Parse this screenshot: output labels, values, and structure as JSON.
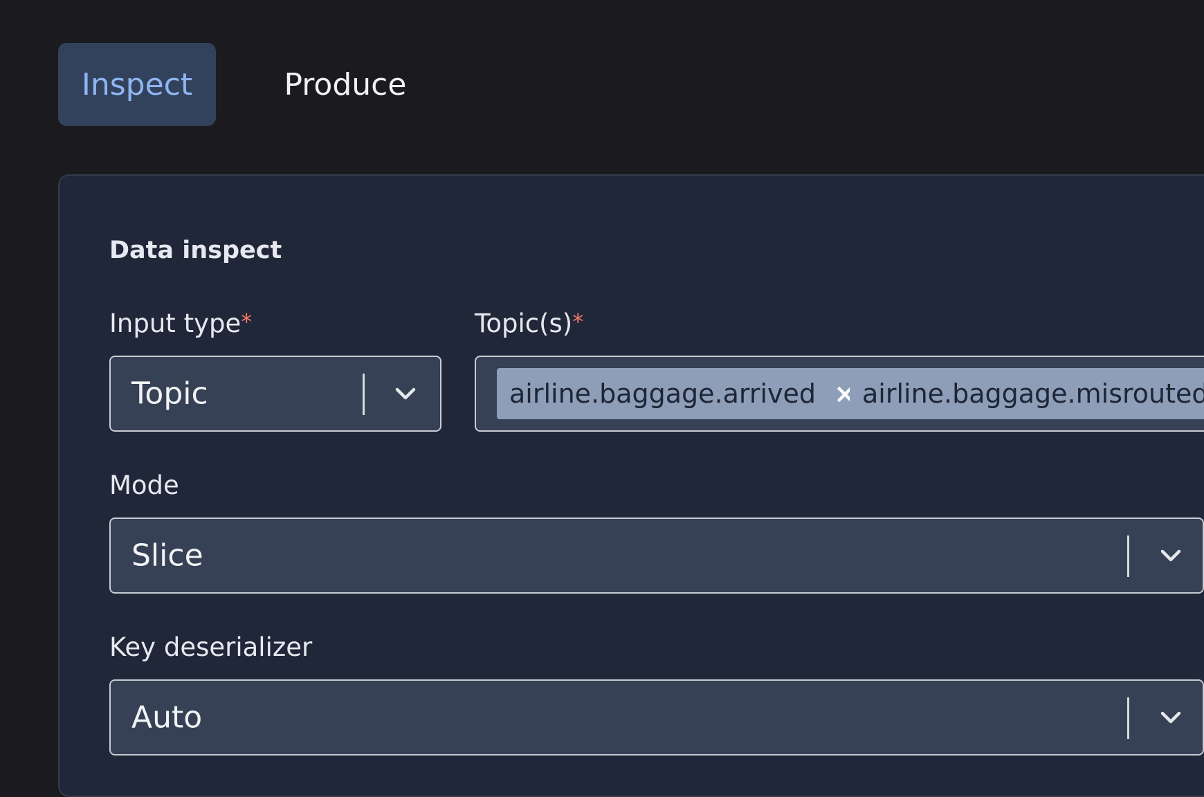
{
  "tabs": [
    {
      "label": "Inspect",
      "active": true
    },
    {
      "label": "Produce",
      "active": false
    }
  ],
  "panel": {
    "title": "Data inspect",
    "input_type": {
      "label": "Input type",
      "required_mark": "*",
      "value": "Topic"
    },
    "topics": {
      "label": "Topic(s)",
      "required_mark": "*",
      "tags": [
        {
          "label": "airline.baggage.arrived",
          "remove_icon": "×"
        },
        {
          "label": "airline.baggage.misrouted",
          "remove_icon": "×"
        }
      ]
    },
    "mode": {
      "label": "Mode",
      "value": "Slice"
    },
    "key_deserializer": {
      "label": "Key deserializer",
      "value": "Auto"
    }
  },
  "colors": {
    "background": "#1b1a1f",
    "panel": "#202739",
    "active_tab_bg": "#33425c",
    "active_tab_text": "#8fb6f2",
    "required": "#f2766a",
    "tag_bg": "#8e9db8"
  },
  "icons": {
    "dropdown": "chevron-down-icon",
    "remove": "close-icon"
  }
}
